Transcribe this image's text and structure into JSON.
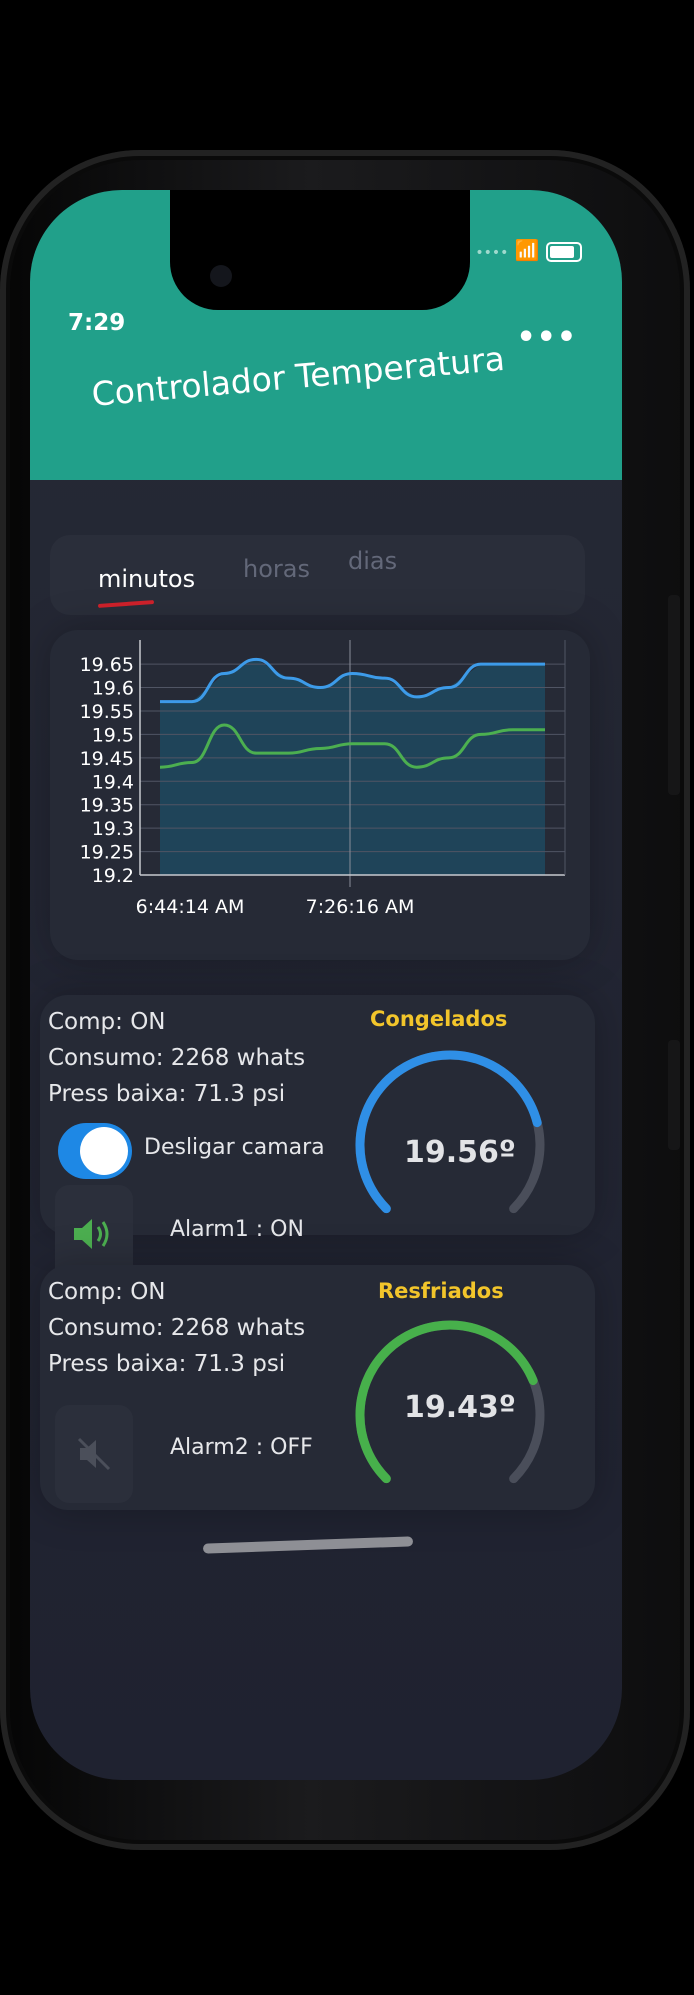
{
  "status": {
    "time": "7:29"
  },
  "header": {
    "title": "Controlador Temperatura",
    "menu_icon": "more-horizontal-icon"
  },
  "tabs": [
    {
      "label": "minutos",
      "active": true
    },
    {
      "label": "horas",
      "active": false
    },
    {
      "label": "dias",
      "active": false
    }
  ],
  "chart_data": {
    "type": "line",
    "y_ticks": [
      "19.65",
      "19.6",
      "19.55",
      "19.5",
      "19.45",
      "19.4",
      "19.35",
      "19.3",
      "19.25",
      "19.2"
    ],
    "x_ticks": [
      "6:44:14 AM",
      "7:26:16 AM"
    ],
    "ylim": [
      19.2,
      19.68
    ],
    "x": [
      0,
      1,
      2,
      3,
      4,
      5,
      6,
      7,
      8,
      9,
      10,
      11,
      12
    ],
    "series": [
      {
        "color": "#3d9be9",
        "values": [
          19.57,
          19.57,
          19.63,
          19.66,
          19.62,
          19.6,
          19.63,
          19.62,
          19.58,
          19.6,
          19.65,
          19.65,
          19.65
        ]
      },
      {
        "color": "#4caf50",
        "values": [
          19.43,
          19.44,
          19.52,
          19.46,
          19.46,
          19.47,
          19.48,
          19.48,
          19.43,
          19.45,
          19.5,
          19.51,
          19.51
        ]
      }
    ],
    "grid": true,
    "colors": {
      "area_fill": "#1d4d66",
      "axis": "#c7c9cf",
      "grid": "#505564"
    }
  },
  "card1": {
    "comp": "Comp:  ON",
    "consumo": "Consumo:  2268 whats",
    "press": "Press baixa:  71.3 psi",
    "toggle_label": "Desligar camara",
    "toggle_on": true,
    "alarm_label": "Alarm1 : ON",
    "alarm_icon": "volume-up-icon",
    "gauge_title": "Congelados",
    "gauge_value": "19.56º",
    "gauge_fraction": 0.78,
    "gauge_color": "#2f8fe6"
  },
  "card2": {
    "comp": "Comp:  ON",
    "consumo": "Consumo:  2268 whats",
    "press": "Press baixa:  71.3 psi",
    "alarm_label": "Alarm2 : OFF",
    "alarm_icon": "volume-off-icon",
    "gauge_title": "Resfriados",
    "gauge_value": "19.43º",
    "gauge_fraction": 0.75,
    "gauge_color": "#47b04b"
  }
}
